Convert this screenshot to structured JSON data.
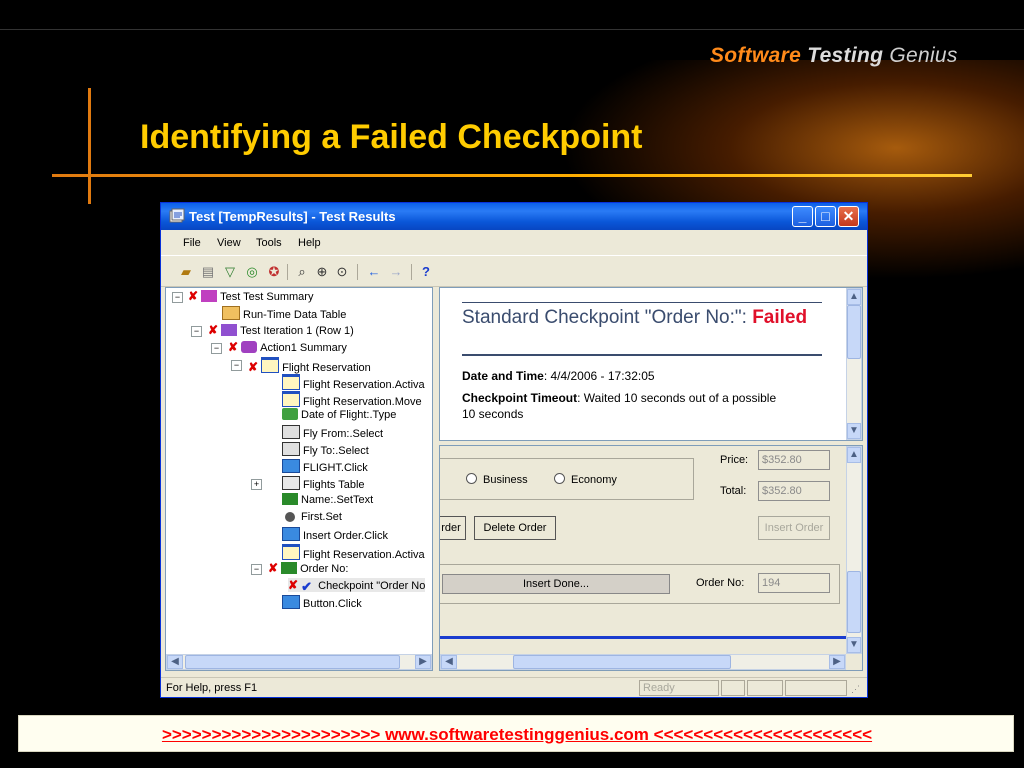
{
  "slide": {
    "logo": {
      "part1": "Software ",
      "part2": "Testing",
      "part3": " Genius"
    },
    "title": "Identifying a Failed Checkpoint",
    "footer": ">>>>>>>>>>>>>>>>>>>>>>  www.softwaretestinggenius.com  <<<<<<<<<<<<<<<<<<<<<<",
    "colors": {
      "accent": "#ffcc00",
      "rule": "#e07a10",
      "footer_text": "#ff0000"
    }
  },
  "window": {
    "title": "Test [TempResults] - Test Results",
    "menu": [
      "File",
      "View",
      "Tools",
      "Help"
    ],
    "toolbar_icons": [
      "open-icon",
      "print-icon",
      "filter-icon",
      "find-icon",
      "report-icon",
      "zoom-out-icon",
      "zoom-in-icon",
      "zoom-icon",
      "back-arrow-icon",
      "forward-arrow-icon",
      "help-icon"
    ],
    "help_label": "?",
    "tree": [
      {
        "label": "Test Test Summary",
        "icon": "summary-icon",
        "failed": true
      },
      {
        "label": "Run-Time Data Table",
        "icon": "table-icon",
        "failed": false
      },
      {
        "label": "Test Iteration 1 (Row 1)",
        "icon": "iteration-icon",
        "failed": true
      },
      {
        "label": "Action1 Summary",
        "icon": "action-icon",
        "failed": true
      },
      {
        "label": "Flight Reservation",
        "icon": "window-icon",
        "failed": true
      },
      {
        "label": "Flight Reservation.Activa",
        "icon": "window-icon",
        "failed": false
      },
      {
        "label": "Flight Reservation.Move",
        "icon": "window-icon",
        "failed": false
      },
      {
        "label": "Date of Flight:.Type",
        "icon": "edit-icon",
        "failed": false
      },
      {
        "label": "Fly From:.Select",
        "icon": "combo-icon",
        "failed": false
      },
      {
        "label": "Fly To:.Select",
        "icon": "combo-icon",
        "failed": false
      },
      {
        "label": "FLIGHT.Click",
        "icon": "button-icon",
        "failed": false
      },
      {
        "label": "Flights Table",
        "icon": "table-icon",
        "failed": false
      },
      {
        "label": "Name:.SetText",
        "icon": "edit-icon",
        "failed": false
      },
      {
        "label": "First.Set",
        "icon": "radio-icon",
        "failed": false
      },
      {
        "label": "Insert Order.Click",
        "icon": "button-icon",
        "failed": false
      },
      {
        "label": "Flight Reservation.Activa",
        "icon": "window-icon",
        "failed": false
      },
      {
        "label": "Order No:",
        "icon": "edit-icon",
        "failed": true
      },
      {
        "label": "Checkpoint \"Order No",
        "icon": "check-icon",
        "failed": true
      },
      {
        "label": "Button.Click",
        "icon": "button-icon",
        "failed": false
      }
    ],
    "checkpoint": {
      "heading": "Standard Checkpoint \"Order No:\": ",
      "status": "Failed",
      "date_label": "Date and Time",
      "date_value": ": 4/4/2006 - 17:32:05",
      "timeout_label": "Checkpoint Timeout",
      "timeout_value": ": Waited 10 seconds out of a possible 10 seconds"
    },
    "app": {
      "radio_business": "Business",
      "radio_economy": "Economy",
      "price_label": "Price:",
      "price_value": "$352.80",
      "total_label": "Total:",
      "total_value": "$352.80",
      "partial_button": "rder",
      "delete_button": "Delete Order",
      "insert_button": "Insert Order",
      "progress_text": "Insert Done...",
      "order_label": "Order No:",
      "order_value": "194"
    },
    "status": {
      "text": "For Help, press F1",
      "state": "Ready"
    }
  }
}
